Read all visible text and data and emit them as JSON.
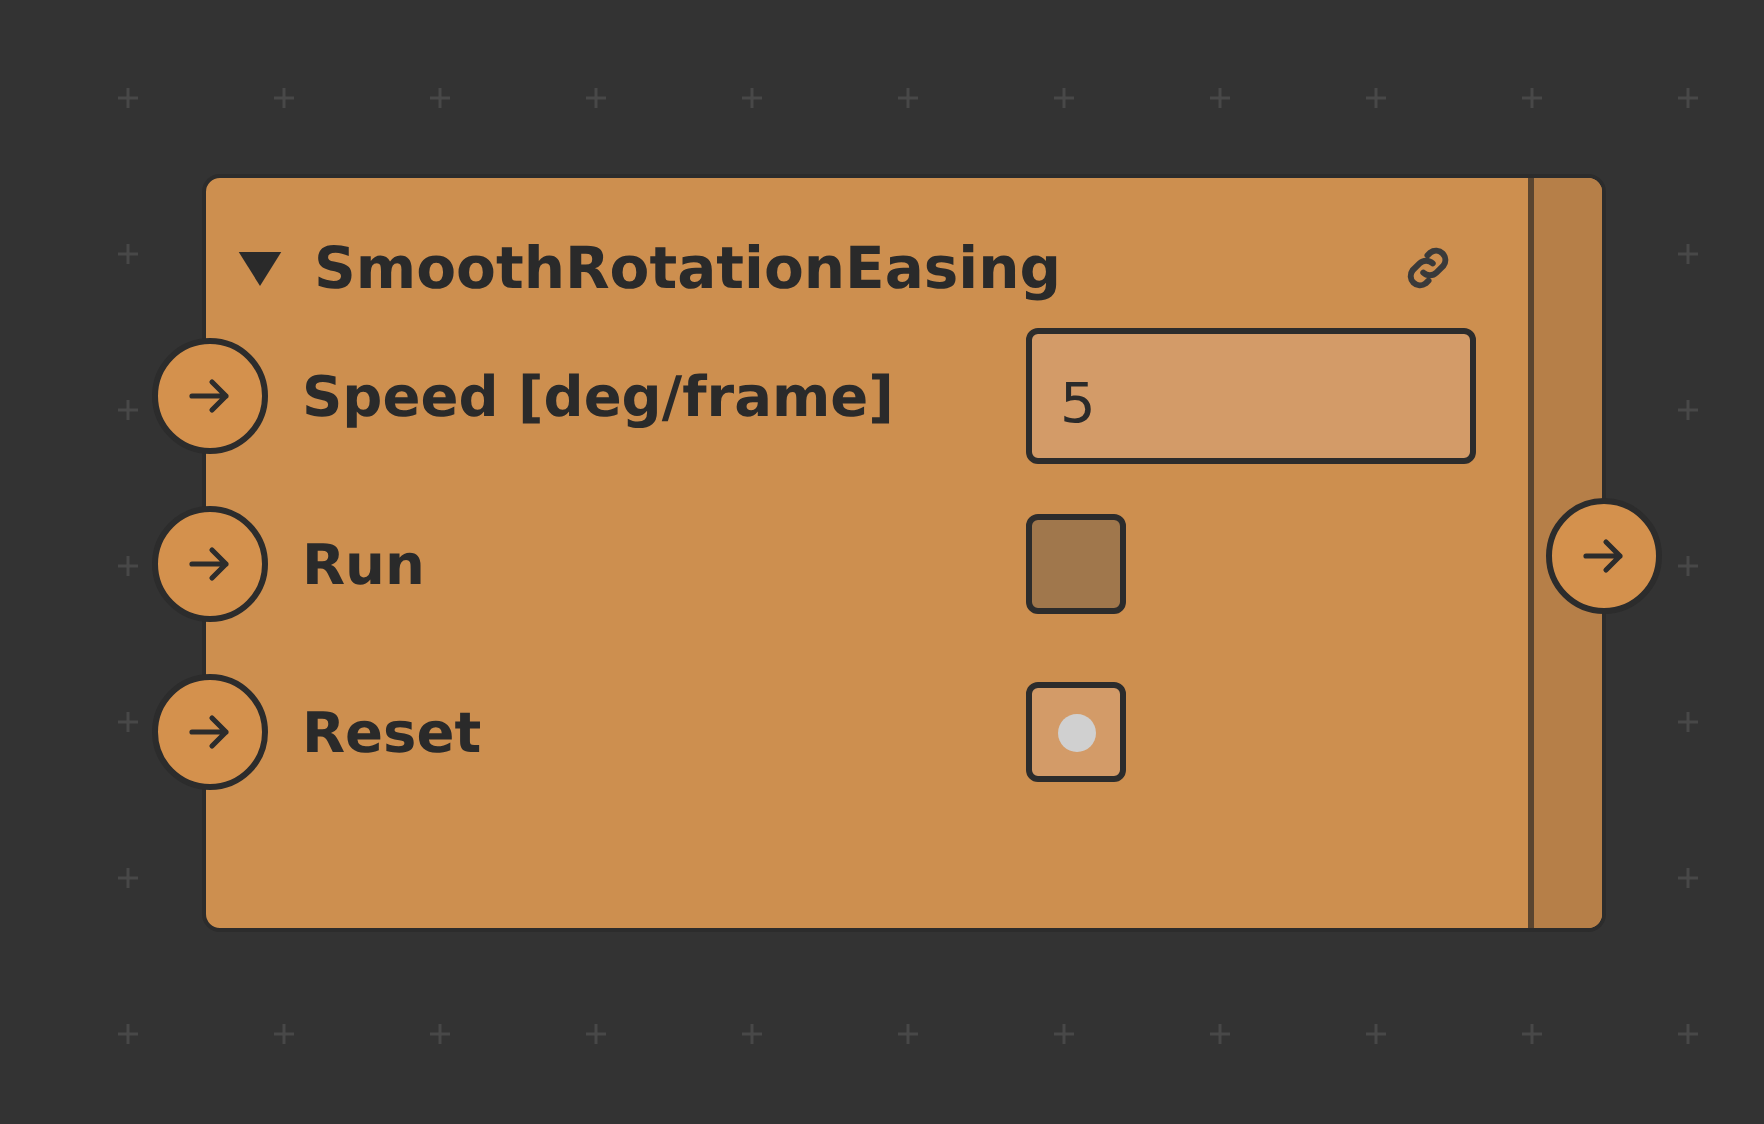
{
  "node": {
    "title": "SmoothRotationEasing",
    "expanded": true,
    "inputs": [
      {
        "kind": "number",
        "label": "Speed [deg/frame]",
        "value": "5"
      },
      {
        "kind": "toggle",
        "label": "Run",
        "on": false
      },
      {
        "kind": "trigger",
        "label": "Reset"
      }
    ]
  }
}
